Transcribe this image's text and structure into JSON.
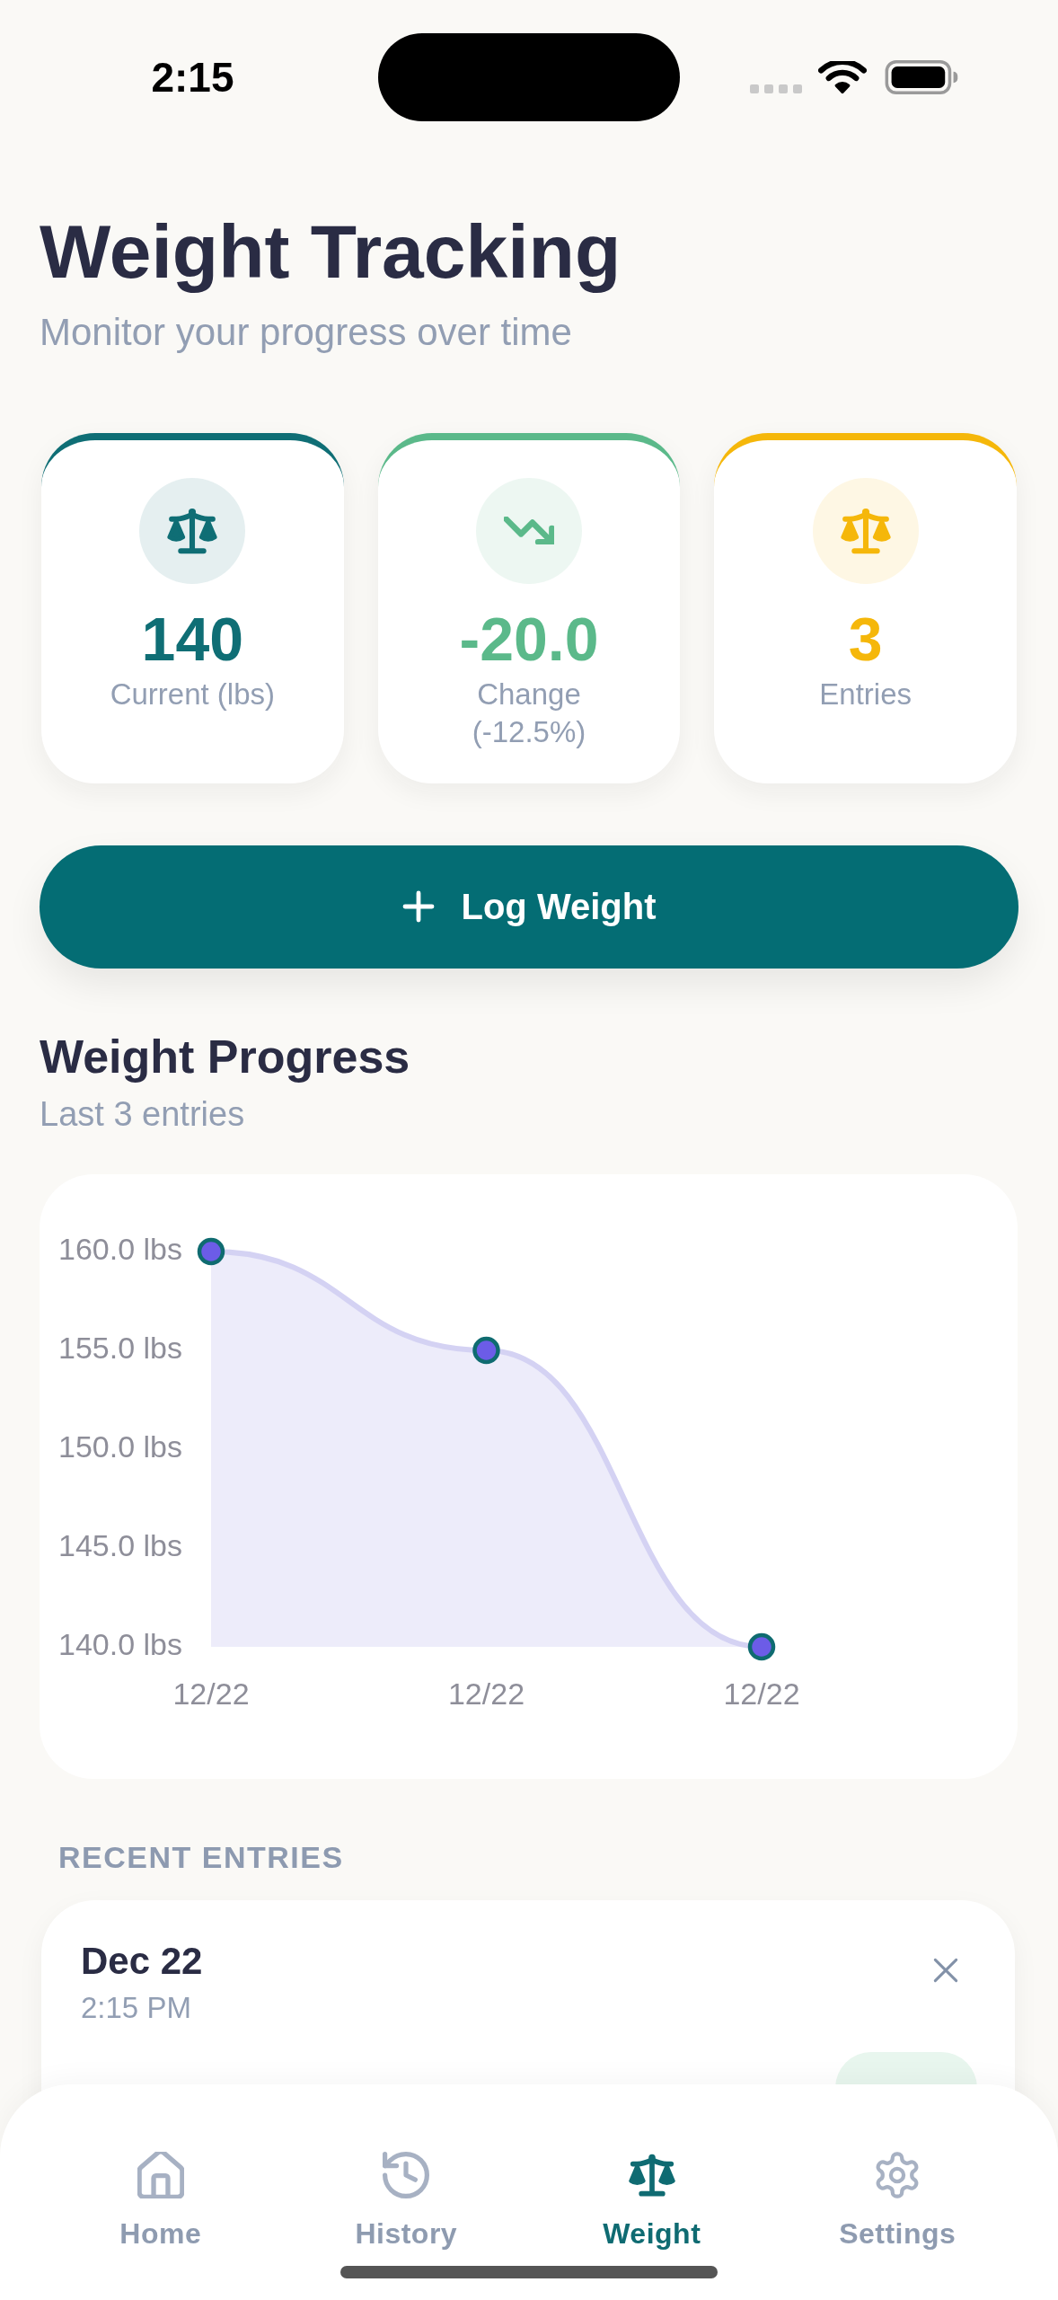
{
  "status_bar": {
    "time": "2:15"
  },
  "header": {
    "title": "Weight Tracking",
    "subtitle": "Monitor your progress over time"
  },
  "stats": [
    {
      "value": "140",
      "label": "Current (lbs)",
      "color": "#0f6e75"
    },
    {
      "value": "-20.0",
      "label": "Change",
      "detail": "(-12.5%)",
      "color": "#5bb98a"
    },
    {
      "value": "3",
      "label": "Entries",
      "color": "#f5b70a"
    }
  ],
  "log_button": {
    "label": "Log Weight"
  },
  "progress": {
    "title": "Weight Progress",
    "subtitle": "Last 3 entries",
    "chart_data": {
      "type": "area",
      "categories": [
        "12/22",
        "12/22",
        "12/22"
      ],
      "values": [
        160,
        155,
        140
      ],
      "ylim": [
        140,
        160
      ],
      "yticks": [
        {
          "value": 140,
          "label": "140.0 lbs"
        },
        {
          "value": 145,
          "label": "145.0 lbs"
        },
        {
          "value": 150,
          "label": "150.0 lbs"
        },
        {
          "value": 155,
          "label": "155.0 lbs"
        },
        {
          "value": 160,
          "label": "160.0 lbs"
        }
      ]
    }
  },
  "recent": {
    "heading": "RECENT ENTRIES",
    "entries": [
      {
        "date": "Dec 22",
        "time": "2:15 PM"
      }
    ]
  },
  "tabs": [
    {
      "label": "Home",
      "selected": false
    },
    {
      "label": "History",
      "selected": false
    },
    {
      "label": "Weight",
      "selected": true
    },
    {
      "label": "Settings",
      "selected": false
    }
  ]
}
